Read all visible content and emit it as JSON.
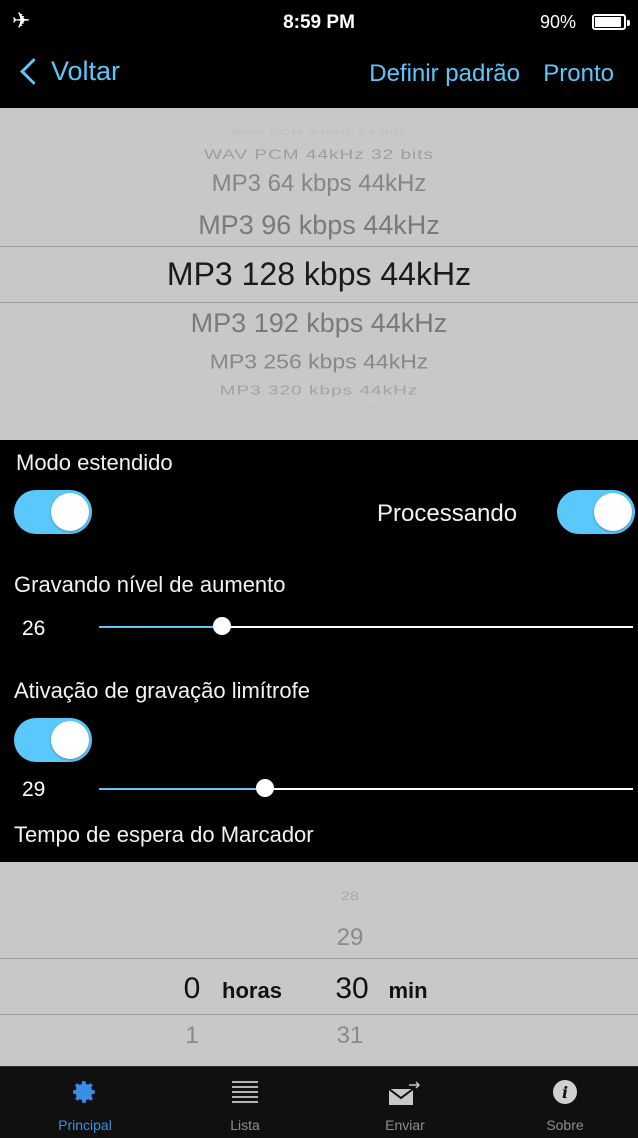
{
  "status_bar": {
    "time": "8:59 PM",
    "battery": "90%"
  },
  "nav": {
    "back_label": "Voltar",
    "set_default_label": "Definir padrão",
    "done_label": "Pronto"
  },
  "format_picker": {
    "items": [
      "WAV PCM 44kHz 24 bits",
      "WAV PCM 44kHz 32 bits",
      "MP3 64 kbps 44kHz",
      "MP3 96 kbps 44kHz",
      "MP3 128 kbps 44kHz",
      "MP3 192 kbps 44kHz",
      "MP3 256 kbps 44kHz",
      "MP3 320 kbps 44kHz",
      "AAC 64 kbps 44kHz"
    ],
    "selected": "MP3 128 kbps 44kHz"
  },
  "settings": {
    "extended_mode_label": "Modo estendido",
    "extended_mode_on": true,
    "processing_label": "Processando",
    "processing_on": true,
    "gain_label": "Gravando nível de aumento",
    "gain_value": "26",
    "gain_fraction": 0.23,
    "threshold_label": "Ativação de gravação limítrofe",
    "threshold_on": true,
    "threshold_value": "29",
    "threshold_fraction": 0.31,
    "marker_label": "Tempo de espera do Marcador"
  },
  "time_picker": {
    "hours_selected": "0",
    "hours_unit": "horas",
    "hours_next": "1",
    "minutes_prev2": "28",
    "minutes_prev1": "29",
    "minutes_selected": "30",
    "minutes_unit": "min",
    "minutes_next": "31"
  },
  "tabs": [
    {
      "label": "Principal",
      "icon": "gear-icon",
      "active": true
    },
    {
      "label": "Lista",
      "icon": "list-icon",
      "active": false
    },
    {
      "label": "Enviar",
      "icon": "send-envelope-icon",
      "active": false
    },
    {
      "label": "Sobre",
      "icon": "info-icon",
      "active": false
    }
  ],
  "colors": {
    "accent": "#5ac8fa",
    "tab_active": "#3a8ee6",
    "picker_bg": "#c8c8c8"
  }
}
